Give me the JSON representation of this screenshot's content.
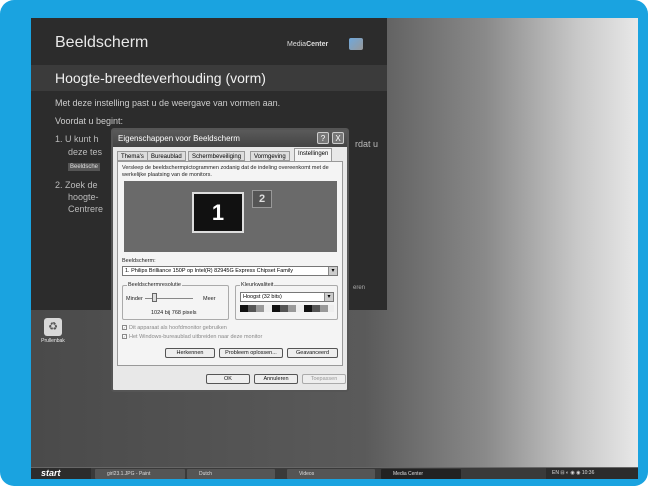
{
  "media_center": {
    "title": "Beeldscherm",
    "brand_prefix": "Media",
    "brand_bold": "Center",
    "heading": "Hoogte-breedteverhouding (vorm)",
    "intro": "Met deze instelling past u de weergave van vormen aan.",
    "before_label": "Voordat u begint:",
    "step1_a": "1.  U kunt h",
    "step1_b": "deze tes",
    "step1_right": "rdat u",
    "button_partial": "Beeldsche",
    "step2_a": "2.  Zoek de",
    "step2_b": "hoogte-",
    "step2_c": "Centrere",
    "right_partial": "eren"
  },
  "desktop": {
    "recycle_bin": "Prullenbak"
  },
  "taskbar": {
    "start": "start",
    "tasks": [
      "girl23.1.JPG - Paint",
      "Dutch",
      "Videos",
      "Media Center"
    ],
    "tray_lang": "EN",
    "clock": "10:36"
  },
  "dialog": {
    "title": "Eigenschappen voor Beeldscherm",
    "help_btn": "?",
    "close_btn": "X",
    "tabs": [
      "Thema's",
      "Bureaublad",
      "Schermbeveiliging",
      "Vormgeving",
      "Instellingen"
    ],
    "description": "Versleep de beeldschermpictogrammen zodanig dat de indeling overeenkomt met de werkelijke plaatsing van de monitors.",
    "monitor1": "1",
    "monitor2": "2",
    "display_label": "Beeldscherm:",
    "display_value": "1. Philips Brilliance 150P op Intel(R) 82945G Express Chipset Family",
    "resolution_label": "Beeldschermresolutie",
    "less": "Minder",
    "more": "Meer",
    "resolution_value": "1024 bij 768 pixels",
    "color_label": "Kleurkwaliteit",
    "color_value": "Hoogst (32 bits)",
    "primary_cb": "Dit apparaat als hoofdmonitor gebruiken",
    "extend_cb": "Het Windows-bureaublad uitbreiden naar deze monitor",
    "identify_btn": "Herkennen",
    "troubleshoot_btn": "Probleem oplossen...",
    "advanced_btn": "Geavanceerd",
    "ok_btn": "OK",
    "cancel_btn": "Annuleren",
    "apply_btn": "Toepassen"
  }
}
